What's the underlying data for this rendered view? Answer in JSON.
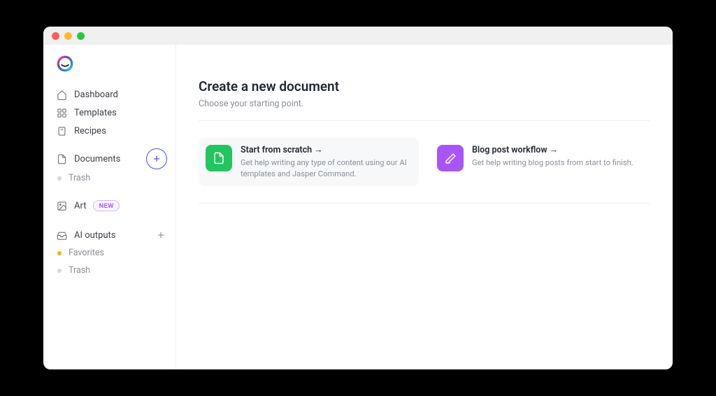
{
  "sidebar": {
    "nav": {
      "dashboard": "Dashboard",
      "templates": "Templates",
      "recipes": "Recipes",
      "documents": "Documents",
      "art": "Art",
      "ai_outputs": "AI outputs"
    },
    "sub": {
      "trash": "Trash",
      "favorites": "Favorites",
      "trash2": "Trash"
    },
    "badge_new": "NEW"
  },
  "main": {
    "heading": "Create a new document",
    "subheading": "Choose your starting point.",
    "cards": {
      "scratch": {
        "title": "Start from scratch",
        "desc": "Get help writing any type of content using our AI templates and Jasper Command."
      },
      "blog": {
        "title": "Blog post workflow",
        "desc": "Get help writing blog posts from start to finish."
      }
    }
  }
}
